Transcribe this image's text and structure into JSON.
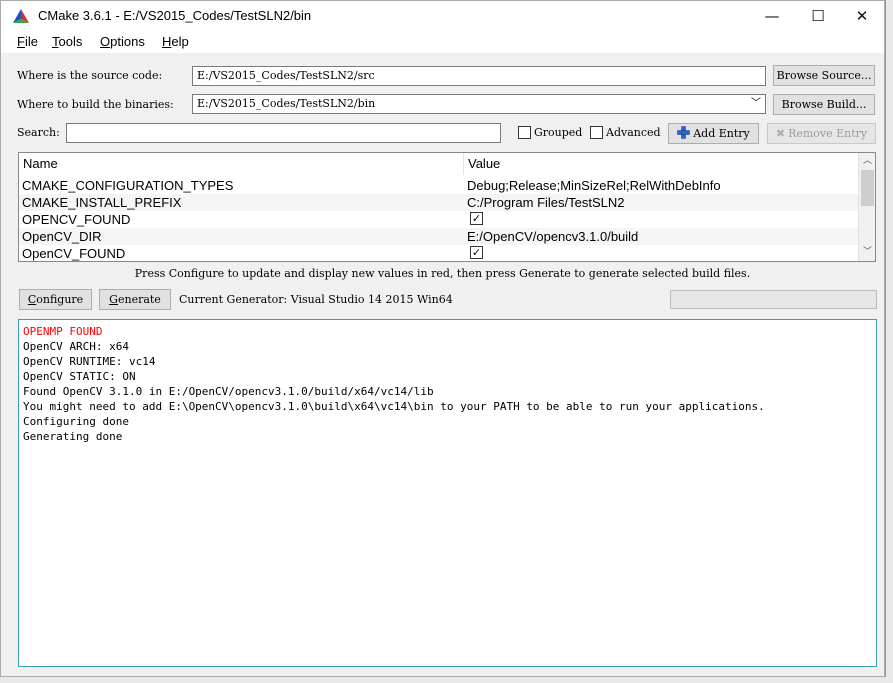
{
  "window": {
    "title": "CMake 3.6.1 - E:/VS2015_Codes/TestSLN2/bin",
    "minimize_glyph": "—",
    "maximize_glyph": "☐",
    "close_glyph": "✕"
  },
  "menu": [
    {
      "label": "File",
      "accel": "F",
      "rest": "ile"
    },
    {
      "label": "Tools",
      "accel": "T",
      "rest": "ools"
    },
    {
      "label": "Options",
      "accel": "O",
      "rest": "ptions"
    },
    {
      "label": "Help",
      "accel": "H",
      "rest": "elp"
    }
  ],
  "source": {
    "label": "Where is the source code:",
    "value": "E:/VS2015_Codes/TestSLN2/src",
    "browse_label": "Browse Source..."
  },
  "build": {
    "label": "Where to build the binaries:",
    "value": "E:/VS2015_Codes/TestSLN2/bin",
    "browse_label": "Browse Build..."
  },
  "search": {
    "label": "Search:",
    "value": ""
  },
  "options": {
    "grouped_label": "Grouped",
    "grouped_checked": false,
    "advanced_label": "Advanced",
    "advanced_checked": false,
    "add_entry_label": "Add Entry",
    "remove_entry_label": "Remove Entry"
  },
  "table": {
    "columns": [
      "Name",
      "Value"
    ],
    "rows": [
      {
        "name": "CMAKE_CONFIGURATION_TYPES",
        "value": "Debug;Release;MinSizeRel;RelWithDebInfo",
        "type": "text"
      },
      {
        "name": "CMAKE_INSTALL_PREFIX",
        "value": "C:/Program Files/TestSLN2",
        "type": "text"
      },
      {
        "name": "OPENCV_FOUND",
        "value": "✓",
        "type": "bool"
      },
      {
        "name": "OpenCV_DIR",
        "value": "E:/OpenCV/opencv3.1.0/build",
        "type": "text"
      },
      {
        "name": "OpenCV_FOUND",
        "value": "✓",
        "type": "bool"
      }
    ]
  },
  "hint": "Press Configure to update and display new values in red, then press Generate to generate selected build files.",
  "actions": {
    "configure_label": "Configure",
    "generate_label": "Generate",
    "generator_text": "Current Generator: Visual Studio 14 2015 Win64"
  },
  "output": {
    "lines": [
      {
        "text": "OPENMP FOUND",
        "color": "#ff0000"
      },
      {
        "text": "OpenCV ARCH: x64"
      },
      {
        "text": "OpenCV RUNTIME: vc14"
      },
      {
        "text": "OpenCV STATIC: ON"
      },
      {
        "text": "Found OpenCV 3.1.0 in E:/OpenCV/opencv3.1.0/build/x64/vc14/lib"
      },
      {
        "text": "You might need to add E:\\OpenCV\\opencv3.1.0\\build\\x64\\vc14\\bin to your PATH to be able to run your applications."
      },
      {
        "text": "Configuring done"
      },
      {
        "text": "Generating done"
      }
    ]
  }
}
